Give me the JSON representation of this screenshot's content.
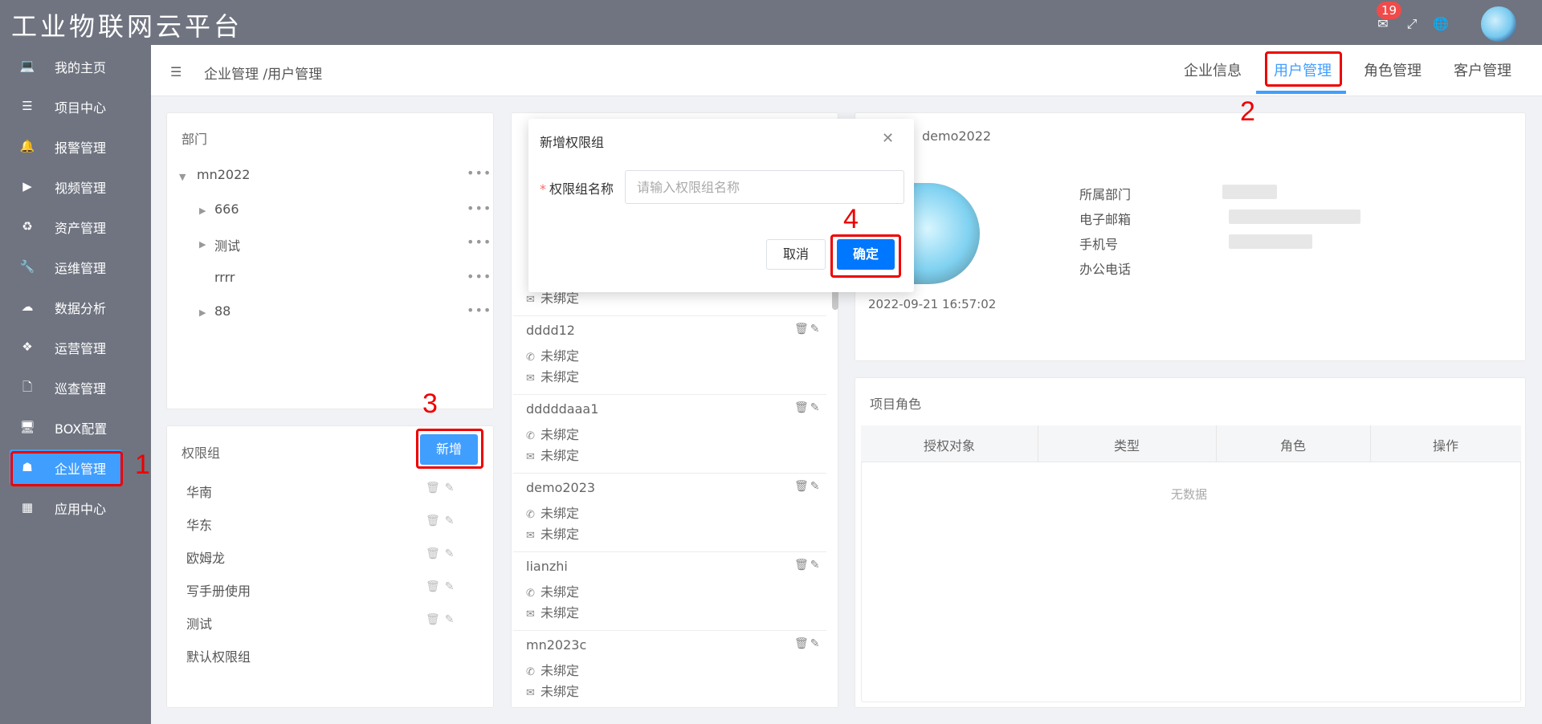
{
  "app": {
    "title": "工业物联网云平台",
    "notification_count": "19"
  },
  "sidebar": {
    "items": [
      {
        "label": "我的主页",
        "icon": "laptop-icon"
      },
      {
        "label": "项目中心",
        "icon": "list-icon"
      },
      {
        "label": "报警管理",
        "icon": "bell-icon"
      },
      {
        "label": "视频管理",
        "icon": "video-icon"
      },
      {
        "label": "资产管理",
        "icon": "recycle-icon"
      },
      {
        "label": "运维管理",
        "icon": "wrench-icon"
      },
      {
        "label": "数据分析",
        "icon": "cloud-icon"
      },
      {
        "label": "运营管理",
        "icon": "cubes-icon"
      },
      {
        "label": "巡查管理",
        "icon": "file-icon"
      },
      {
        "label": "BOX配置",
        "icon": "desktop-icon"
      },
      {
        "label": "企业管理",
        "icon": "sitemap-icon",
        "active": true
      },
      {
        "label": "应用中心",
        "icon": "grid-icon"
      }
    ]
  },
  "header": {
    "breadcrumb": "企业管理 /用户管理",
    "tabs": [
      "企业信息",
      "用户管理",
      "角色管理",
      "客户管理"
    ],
    "active_tab": "用户管理"
  },
  "annotations": [
    "1",
    "2",
    "3",
    "4"
  ],
  "department": {
    "title": "部门",
    "tree": [
      {
        "label": "mn2022",
        "expanded": true
      },
      {
        "label": "666"
      },
      {
        "label": "测试"
      },
      {
        "label": "rrrr"
      },
      {
        "label": "88"
      }
    ]
  },
  "permission_groups": {
    "title": "权限组",
    "add_label": "新增",
    "items": [
      "华南",
      "华东",
      "欧姆龙",
      "写手册使用",
      "测试",
      "默认权限组"
    ]
  },
  "users": {
    "unbound": "未绑定",
    "items": [
      "dddd12",
      "dddddaaa1",
      "demo2023",
      "lianzhi",
      "mn2023c"
    ]
  },
  "user_detail": {
    "name": "demo2022",
    "created": "2022-09-21 16:57:02",
    "labels": [
      "所属部门",
      "电子邮箱",
      "手机号",
      "办公电话"
    ]
  },
  "project_roles": {
    "title": "项目角色",
    "columns": [
      "授权对象",
      "类型",
      "角色",
      "操作"
    ],
    "empty_text": "无数据"
  },
  "dialog": {
    "title": "新增权限组",
    "field_label": "权限组名称",
    "placeholder": "请输入权限组名称",
    "cancel": "取消",
    "confirm": "确定"
  },
  "colors": {
    "accent": "#409eff",
    "sidebar": "#6f7480",
    "annotation": "#e00000"
  }
}
